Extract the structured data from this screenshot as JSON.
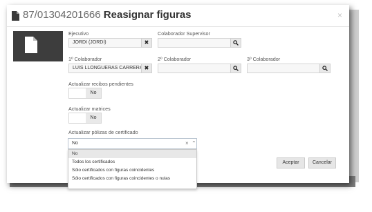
{
  "title": {
    "number": "87/01304201666",
    "text": "Reasignar figuras"
  },
  "icons": {
    "title": "document-icon",
    "close": "close-icon",
    "avatar": "document-icon"
  },
  "close_label": "×",
  "fields": {
    "ejecutivo": {
      "label": "Ejecutivo",
      "value": "JORDI (JORDI)",
      "btn": "✖"
    },
    "colaborador_supervisor": {
      "label": "Colaborador Supervisor",
      "value": "",
      "btn": "🔍"
    },
    "colaborador1": {
      "label": "1º Colaborador",
      "value": "LUIS LLONGUERAS CARRERA",
      "btn": "✖"
    },
    "colaborador2": {
      "label": "2º Colaborador",
      "value": "",
      "btn": "🔍"
    },
    "colaborador3": {
      "label": "3º Colaborador",
      "value": "",
      "btn": "🔍"
    }
  },
  "toggles": {
    "recibos": {
      "label": "Actualizar recibos pendientes",
      "value": "No"
    },
    "matrices": {
      "label": "Actualizar matrices",
      "value": "No"
    }
  },
  "polizas": {
    "label": "Actualizar pólizas de certificado",
    "selected": "No",
    "clear": "×",
    "caret": "⌃",
    "options": [
      "No",
      "Todos los certificados",
      "Sólo certificados con figuras coincidentes",
      "Sólo certificados con figuras coincidentes o nulas"
    ]
  },
  "buttons": {
    "accept": "Aceptar",
    "cancel": "Cancelar"
  }
}
